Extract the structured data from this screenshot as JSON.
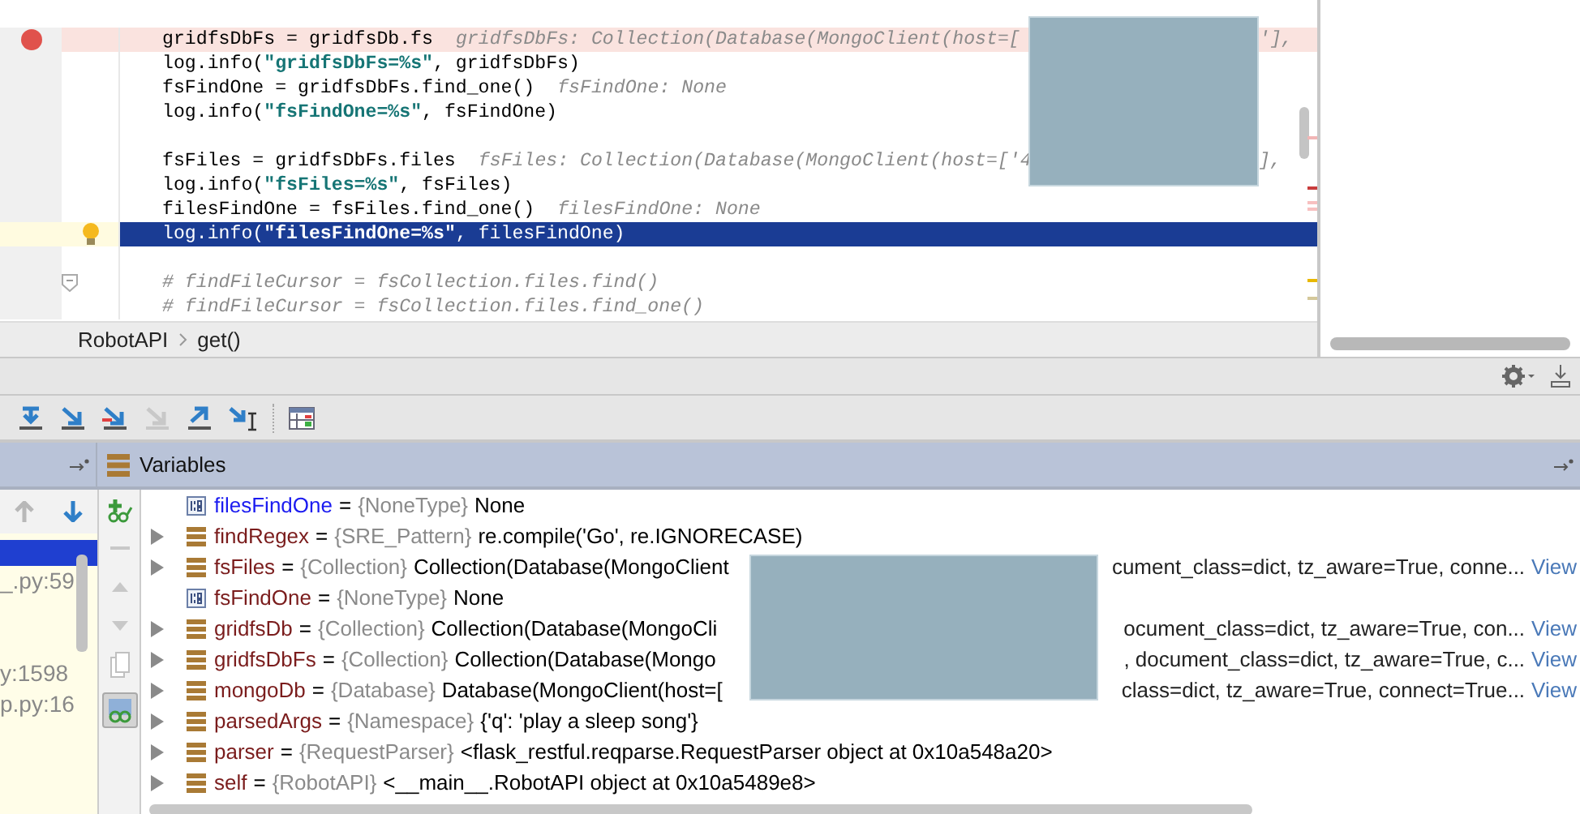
{
  "editor": {
    "lines": [
      {
        "breakpoint": true,
        "current": false,
        "gap_before": false,
        "fold": false,
        "segments": [
          {
            "kind": "code",
            "text": "gridfsDbFs = gridfsDb.fs"
          }
        ],
        "hint": "gridfsDbFs: Collection(Database(MongoClient(host=[",
        "hint_tail": "'],"
      },
      {
        "breakpoint": false,
        "current": false,
        "gap_before": false,
        "fold": false,
        "segments": [
          {
            "kind": "code",
            "text": "log.info("
          },
          {
            "kind": "string",
            "text": "\"gridfsDbFs=%s\""
          },
          {
            "kind": "code",
            "text": ", gridfsDbFs)"
          }
        ]
      },
      {
        "breakpoint": false,
        "current": false,
        "gap_before": false,
        "fold": false,
        "segments": [
          {
            "kind": "code",
            "text": "fsFindOne = gridfsDbFs.find_one()"
          }
        ],
        "hint": "fsFindOne: None"
      },
      {
        "breakpoint": false,
        "current": false,
        "gap_before": false,
        "fold": false,
        "segments": [
          {
            "kind": "code",
            "text": "log.info("
          },
          {
            "kind": "string",
            "text": "\"fsFindOne=%s\""
          },
          {
            "kind": "code",
            "text": ", fsFindOne)"
          }
        ]
      },
      {
        "breakpoint": false,
        "current": false,
        "gap_before": true,
        "fold": false,
        "segments": [
          {
            "kind": "code",
            "text": "fsFiles = gridfsDbFs.files"
          }
        ],
        "hint": "fsFiles: Collection(Database(MongoClient(host=['4",
        "hint_tail": "],"
      },
      {
        "breakpoint": false,
        "current": false,
        "gap_before": false,
        "fold": false,
        "segments": [
          {
            "kind": "code",
            "text": "log.info("
          },
          {
            "kind": "string",
            "text": "\"fsFiles=%s\""
          },
          {
            "kind": "code",
            "text": ", fsFiles)"
          }
        ]
      },
      {
        "breakpoint": false,
        "current": false,
        "gap_before": false,
        "fold": false,
        "segments": [
          {
            "kind": "code",
            "text": "filesFindOne = fsFiles.find_one()"
          }
        ],
        "hint": "filesFindOne: None"
      },
      {
        "breakpoint": false,
        "current": true,
        "gap_before": false,
        "fold": false,
        "segments": [
          {
            "kind": "code",
            "text": "log.info("
          },
          {
            "kind": "string",
            "text": "\"filesFindOne=%s\""
          },
          {
            "kind": "code",
            "text": ", filesFindOne)"
          }
        ]
      },
      {
        "breakpoint": false,
        "current": false,
        "gap_before": true,
        "fold": true,
        "segments": [
          {
            "kind": "comment",
            "text": "# findFileCursor = fsCollection.files.find()"
          }
        ]
      },
      {
        "breakpoint": false,
        "current": false,
        "gap_before": false,
        "fold": false,
        "segments": [
          {
            "kind": "comment",
            "text": "# findFileCursor = fsCollection.files.find_one()"
          }
        ]
      }
    ]
  },
  "breadcrumb": [
    "RobotAPI",
    "get()"
  ],
  "debugger": {
    "panel_title": "Variables",
    "frames": [
      {
        "selected": true
      },
      {
        "text": "_.py:59",
        "selected": false
      },
      {
        "selected": false
      },
      {
        "selected": false
      },
      {
        "text": "y:1598",
        "selected": false
      },
      {
        "text": "p.py:16",
        "selected": false
      }
    ],
    "variables": [
      {
        "name": "filesFindOne",
        "operator": "=",
        "type": "{NoneType}",
        "value": "None",
        "expandable": false,
        "kind": "none",
        "changed": true
      },
      {
        "name": "findRegex",
        "operator": "=",
        "type": "{SRE_Pattern}",
        "value": "re.compile('Go', re.IGNORECASE)",
        "expandable": true,
        "kind": "object",
        "changed": false
      },
      {
        "name": "fsFiles",
        "operator": "=",
        "type": "{Collection}",
        "value": "Collection(Database(MongoClient",
        "tail": "cument_class=dict, tz_aware=True, conne...",
        "link": "View",
        "expandable": true,
        "kind": "object",
        "changed": false
      },
      {
        "name": "fsFindOne",
        "operator": "=",
        "type": "{NoneType}",
        "value": "None",
        "expandable": false,
        "kind": "none",
        "changed": false
      },
      {
        "name": "gridfsDb",
        "operator": "=",
        "type": "{Collection}",
        "value": "Collection(Database(MongoCli",
        "tail": "ocument_class=dict, tz_aware=True, con...",
        "link": "View",
        "expandable": true,
        "kind": "object",
        "changed": false
      },
      {
        "name": "gridfsDbFs",
        "operator": "=",
        "type": "{Collection}",
        "value": "Collection(Database(Mongo",
        "tail": ", document_class=dict, tz_aware=True, c...",
        "link": "View",
        "expandable": true,
        "kind": "object",
        "changed": false
      },
      {
        "name": "mongoDb",
        "operator": "=",
        "type": "{Database}",
        "value": "Database(MongoClient(host=[",
        "tail": "class=dict, tz_aware=True, connect=True...",
        "link": "View",
        "expandable": true,
        "kind": "object",
        "changed": false
      },
      {
        "name": "parsedArgs",
        "operator": "=",
        "type": "{Namespace}",
        "value": "{'q': 'play a sleep song'}",
        "expandable": true,
        "kind": "object",
        "changed": false
      },
      {
        "name": "parser",
        "operator": "=",
        "type": "{RequestParser}",
        "value": "<flask_restful.reqparse.RequestParser object at 0x10a548a20>",
        "expandable": true,
        "kind": "object",
        "changed": false
      },
      {
        "name": "self",
        "operator": "=",
        "type": "{RobotAPI}",
        "value": "<__main__.RobotAPI object at 0x10a5489e8>",
        "expandable": true,
        "kind": "object",
        "changed": false
      }
    ]
  }
}
